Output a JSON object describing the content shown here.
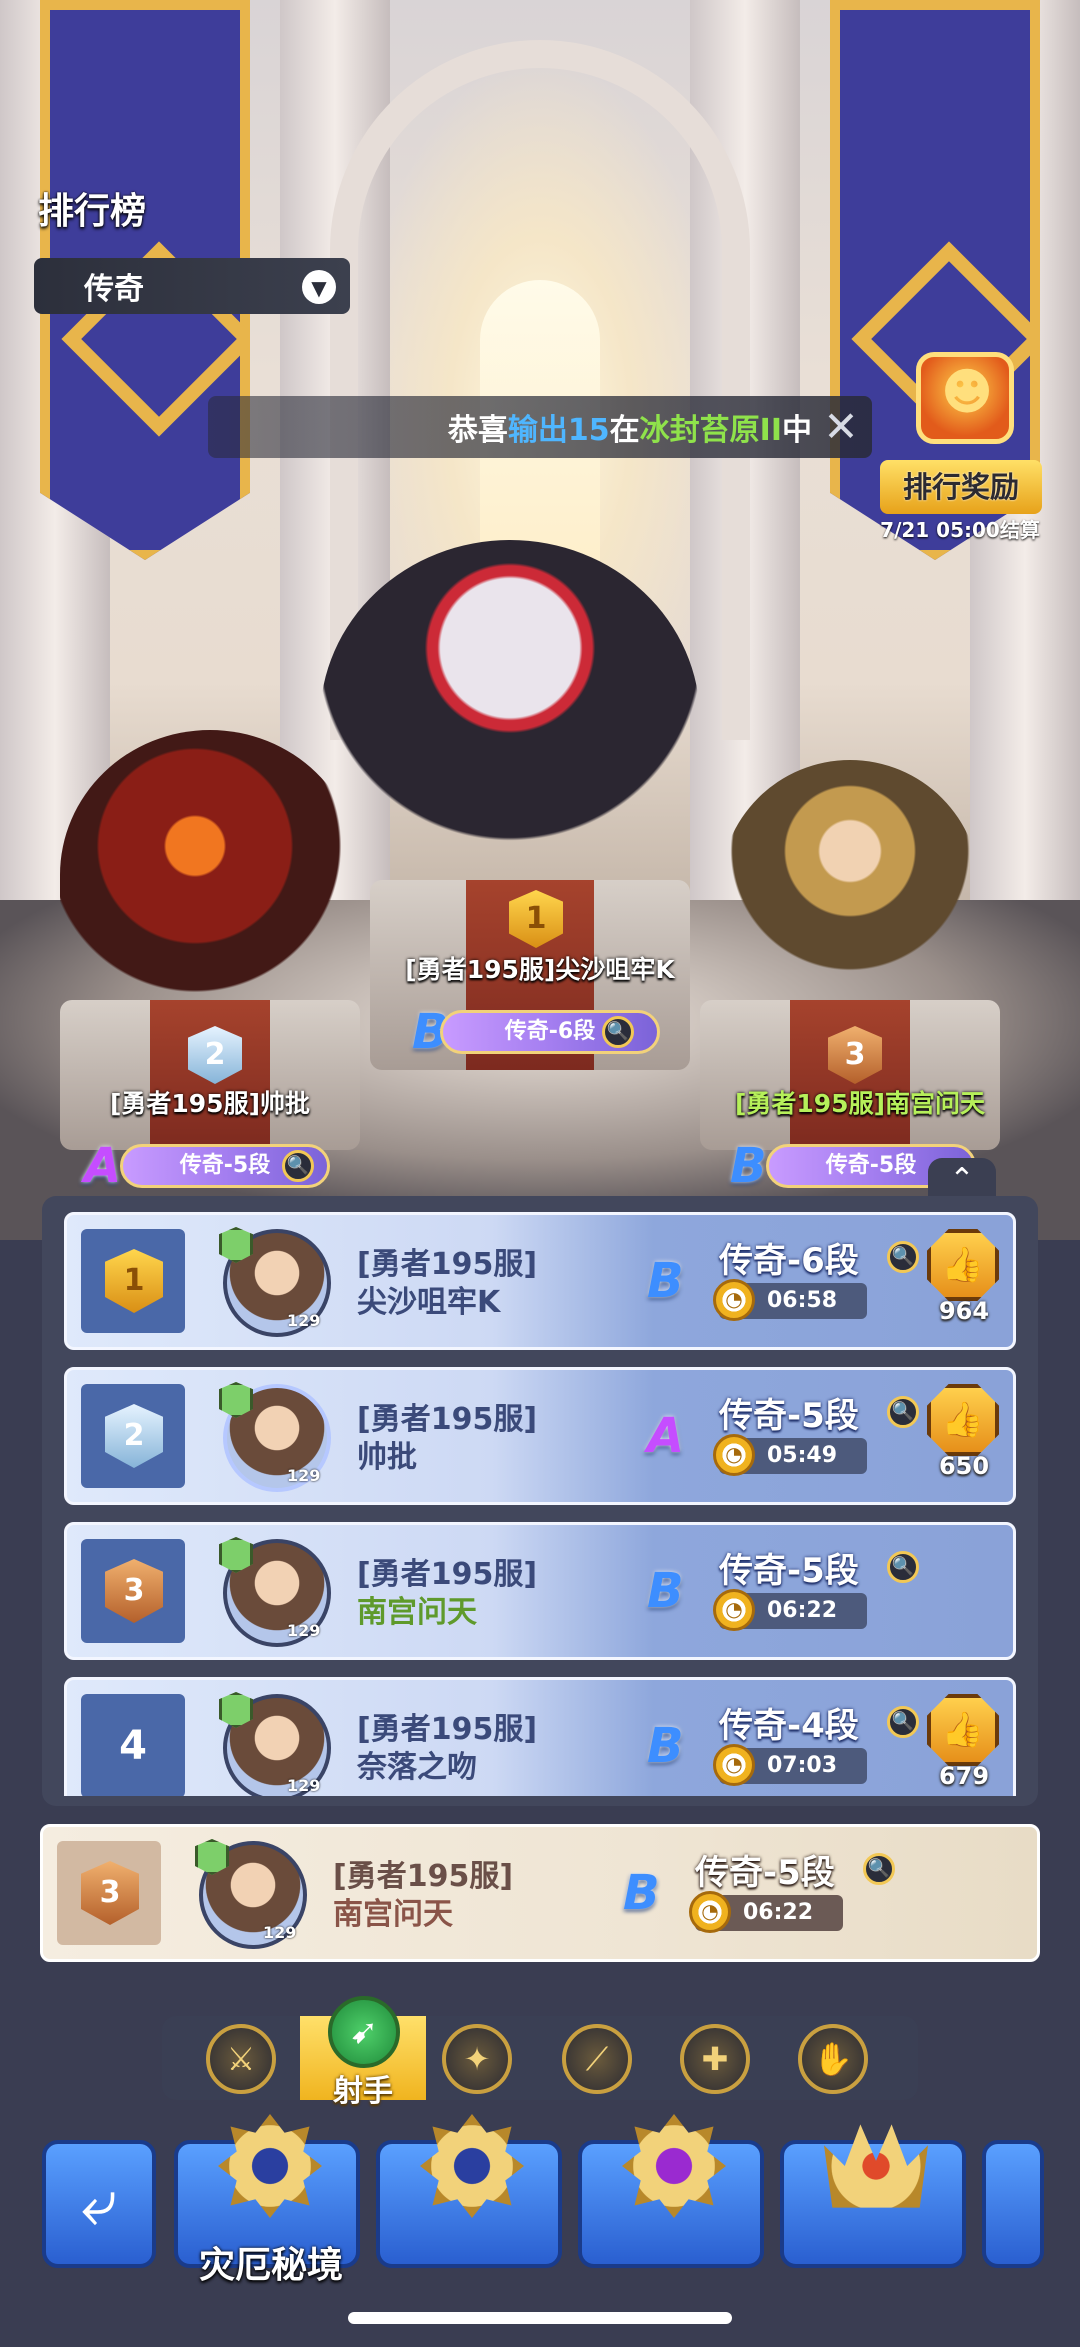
{
  "header": {
    "title": "排行榜",
    "dropdown_value": "传奇",
    "marquee": {
      "prefix": "恭喜",
      "player": "输出15",
      "mid": "在",
      "place": "冰封苔原II",
      "suffix": "中"
    }
  },
  "reward": {
    "label": "排行奖励",
    "settle_time": "7/21 05:00结算"
  },
  "podium": [
    {
      "rank": "1",
      "name": "[勇者195服]尖沙咀牢K",
      "tier": "传奇-6段",
      "grade": "B"
    },
    {
      "rank": "2",
      "name": "[勇者195服]帅批",
      "tier": "传奇-5段",
      "grade": "A"
    },
    {
      "rank": "3",
      "name": "[勇者195服]南宫问天",
      "tier": "传奇-5段",
      "grade": "B"
    }
  ],
  "rows": [
    {
      "rank": "1",
      "server": "[勇者195服]",
      "name": "尖沙咀牢K",
      "tier": "传奇-6段",
      "time": "06:58",
      "grade": "B",
      "likes": "964",
      "level": "129"
    },
    {
      "rank": "2",
      "server": "[勇者195服]",
      "name": "帅批",
      "tier": "传奇-5段",
      "time": "05:49",
      "grade": "A",
      "likes": "650",
      "level": "129"
    },
    {
      "rank": "3",
      "server": "[勇者195服]",
      "name": "南宫问天",
      "tier": "传奇-5段",
      "time": "06:22",
      "grade": "B",
      "likes": "",
      "level": "129"
    },
    {
      "rank": "4",
      "server": "[勇者195服]",
      "name": "奈落之吻",
      "tier": "传奇-4段",
      "time": "07:03",
      "grade": "B",
      "likes": "679",
      "level": "129"
    }
  ],
  "my_rank": {
    "rank": "3",
    "server": "[勇者195服]",
    "name": "南宫问天",
    "tier": "传奇-5段",
    "time": "06:22",
    "grade": "B",
    "level": "129"
  },
  "class_tabs": {
    "active_label": "射手",
    "icons": [
      "warrior-axe-icon",
      "archer-bow-icon",
      "mage-staff-icon",
      "blade-icon",
      "cross-shield-icon",
      "magic-hand-icon"
    ]
  },
  "bottom_nav": {
    "mode_label": "灾厄秘境"
  },
  "icons": {
    "dropdown": "▼",
    "close": "✕",
    "search": "🔍",
    "collapse": "⌃",
    "back": "⤶",
    "like": "👍",
    "clock": "◔"
  },
  "colors": {
    "accent_blue": "#4fb6ff",
    "accent_green": "#8fe24b",
    "gold": "#f2d27a"
  }
}
